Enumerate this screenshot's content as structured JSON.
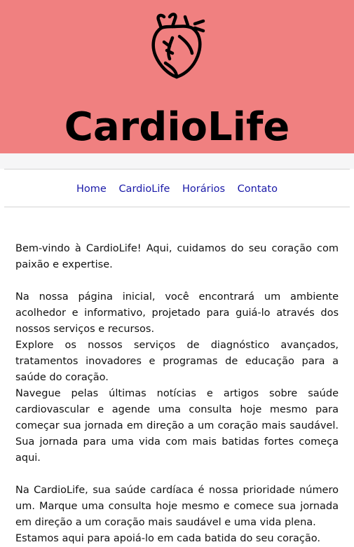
{
  "header": {
    "logo_icon": "anatomical-heart-icon",
    "brand": "CardioLife",
    "background": "#f08080"
  },
  "nav": {
    "items": [
      {
        "label": "Home"
      },
      {
        "label": "CardioLife"
      },
      {
        "label": "Horários"
      },
      {
        "label": "Contato"
      }
    ],
    "link_color": "#1a1aa8"
  },
  "content": {
    "paragraphs": [
      "Bem-vindo à CardioLife! Aqui, cuidamos do seu coração com paixão e expertise.",
      "Na nossa página inicial, você encontrará um ambiente acolhedor e informativo, projetado para guiá-lo através dos nossos serviços e recursos.",
      "Explore os nossos serviços de diagnóstico avançados, tratamentos inovadores e programas de educação para a saúde do coração.",
      "Navegue pelas últimas notícias e artigos sobre saúde cardiovascular e agende uma consulta hoje mesmo para começar sua jornada em direção a um coração mais saudável. Sua jornada para uma vida com mais batidas fortes começa aqui.",
      "Na CardioLife, sua saúde cardíaca é nossa prioridade número um. Marque uma consulta hoje mesmo e comece sua jornada em direção a um coração mais saudável e uma vida plena.",
      "Estamos aqui para apoiá-lo em cada batida do seu coração."
    ]
  }
}
